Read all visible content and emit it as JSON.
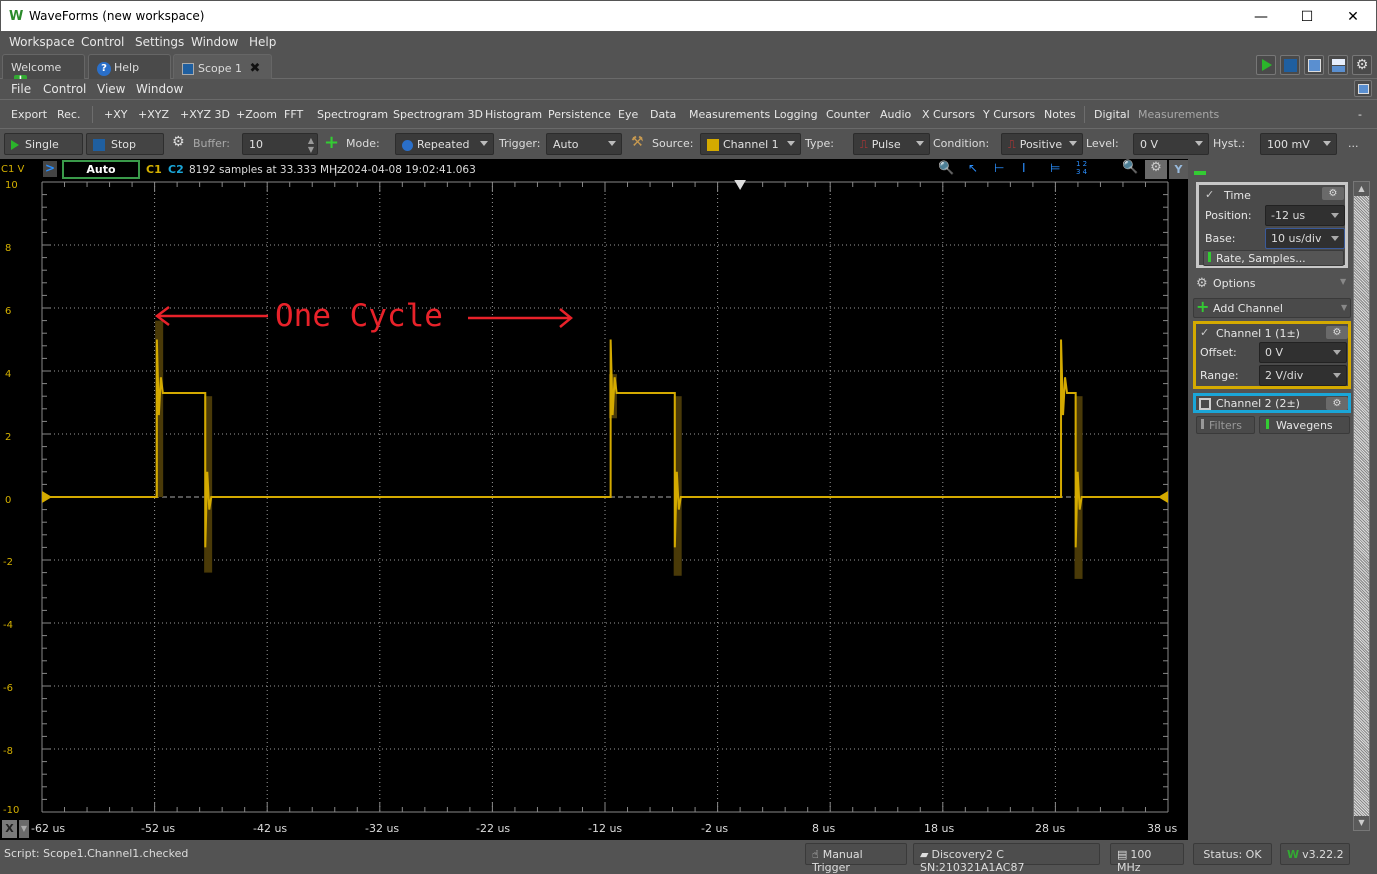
{
  "window": {
    "title": "WaveForms (new workspace)",
    "logo": "W",
    "minimize": "—",
    "maximize": "☐",
    "close": "✕"
  },
  "main_menu": [
    "Workspace",
    "Control",
    "Settings",
    "Window",
    "Help"
  ],
  "tabs": [
    {
      "label": "Welcome",
      "icon": "plus-icon"
    },
    {
      "label": "Help",
      "icon": "help-icon"
    },
    {
      "label": "Scope 1",
      "icon": "scope-icon",
      "close": "✖",
      "active": true
    }
  ],
  "scope_menu": [
    "File",
    "Control",
    "View",
    "Window"
  ],
  "instruments": [
    "Export",
    "Rec.",
    "+XY",
    "+XYZ",
    "+XYZ 3D",
    "+Zoom",
    "FFT",
    "Spectrogram",
    "Spectrogram 3D",
    "Histogram",
    "Persistence",
    "Eye",
    "Data",
    "Measurements",
    "Logging",
    "Counter",
    "Audio",
    "X Cursors",
    "Y Cursors",
    "Notes",
    "Digital",
    "Measurements"
  ],
  "instruments_more": "-",
  "control": {
    "single": "Single",
    "stop": "Stop",
    "buffer_label": "Buffer:",
    "buffer_value": "10",
    "mode_label": "Mode:",
    "mode_value": "Repeated",
    "trigger_label": "Trigger:",
    "trigger_value": "Auto",
    "source_label": "Source:",
    "source_value": "Channel 1",
    "type_label": "Type:",
    "type_value": "Pulse",
    "condition_label": "Condition:",
    "condition_value": "Positive",
    "level_label": "Level:",
    "level_value": "0 V",
    "hyst_label": "Hyst.:",
    "hyst_value": "100 mV",
    "more": "..."
  },
  "plot_header": {
    "y_unit": "C1 V",
    "auto": "Auto",
    "c1": "C1",
    "c2": "C2",
    "info": "8192 samples at 33.333 MHz",
    "timestamp": "| 2024-04-08 19:02:41.063",
    "y_button": "Y"
  },
  "y_ticks": [
    "10",
    "8",
    "6",
    "4",
    "2",
    "0",
    "-2",
    "-4",
    "-6",
    "-8",
    "-10"
  ],
  "x_ticks": [
    "-62 us",
    "-52 us",
    "-42 us",
    "-32 us",
    "-22 us",
    "-12 us",
    "-2 us",
    "8 us",
    "18 us",
    "28 us",
    "38 us"
  ],
  "x_button": "X",
  "annotation": {
    "text": "One Cycle",
    "color": "#e8222a"
  },
  "waveform": {
    "color": "#d4aa00",
    "high_level_v": 3.3,
    "low_level_v": 0,
    "rising_edges_us": [
      -51.8,
      -11.5,
      28.5
    ],
    "falling_edges_us": [
      -47.5,
      -5.8,
      29.8
    ]
  },
  "right_panel": {
    "time": {
      "title": "Time",
      "position_label": "Position:",
      "position_value": "-12 us",
      "base_label": "Base:",
      "base_value": "10 us/div",
      "rate_button": "Rate, Samples..."
    },
    "options": "Options",
    "add_channel": "Add Channel",
    "channel1": {
      "title": "Channel 1 (1±)",
      "checked": true,
      "offset_label": "Offset:",
      "offset_value": "0 V",
      "range_label": "Range:",
      "range_value": "2 V/div",
      "color": "#d4aa00"
    },
    "channel2": {
      "title": "Channel 2 (2±)",
      "checked": false,
      "color": "#1aa6d8"
    },
    "filters": "Filters",
    "wavegens": "Wavegens"
  },
  "status": {
    "script": "Script: Scope1.Channel1.checked",
    "manual_trigger": "Manual Trigger",
    "device": "Discovery2 C SN:210321A1AC87",
    "clock": "100 MHz",
    "status": "Status: OK",
    "version": "v3.22.2"
  }
}
